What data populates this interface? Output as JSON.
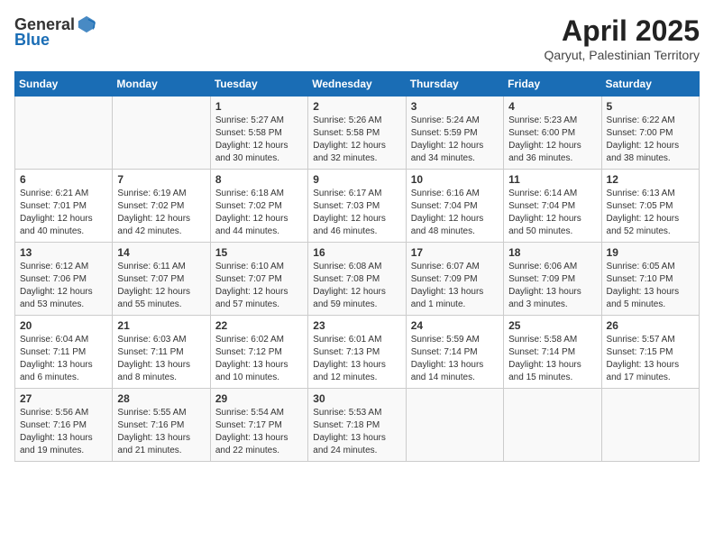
{
  "header": {
    "logo": {
      "text_general": "General",
      "text_blue": "Blue"
    },
    "title": "April 2025",
    "subtitle": "Qaryut, Palestinian Territory"
  },
  "calendar": {
    "days_of_week": [
      "Sunday",
      "Monday",
      "Tuesday",
      "Wednesday",
      "Thursday",
      "Friday",
      "Saturday"
    ],
    "weeks": [
      [
        {
          "day": "",
          "info": ""
        },
        {
          "day": "",
          "info": ""
        },
        {
          "day": "1",
          "info": "Sunrise: 5:27 AM\nSunset: 5:58 PM\nDaylight: 12 hours\nand 30 minutes."
        },
        {
          "day": "2",
          "info": "Sunrise: 5:26 AM\nSunset: 5:58 PM\nDaylight: 12 hours\nand 32 minutes."
        },
        {
          "day": "3",
          "info": "Sunrise: 5:24 AM\nSunset: 5:59 PM\nDaylight: 12 hours\nand 34 minutes."
        },
        {
          "day": "4",
          "info": "Sunrise: 5:23 AM\nSunset: 6:00 PM\nDaylight: 12 hours\nand 36 minutes."
        },
        {
          "day": "5",
          "info": "Sunrise: 6:22 AM\nSunset: 7:00 PM\nDaylight: 12 hours\nand 38 minutes."
        }
      ],
      [
        {
          "day": "6",
          "info": "Sunrise: 6:21 AM\nSunset: 7:01 PM\nDaylight: 12 hours\nand 40 minutes."
        },
        {
          "day": "7",
          "info": "Sunrise: 6:19 AM\nSunset: 7:02 PM\nDaylight: 12 hours\nand 42 minutes."
        },
        {
          "day": "8",
          "info": "Sunrise: 6:18 AM\nSunset: 7:02 PM\nDaylight: 12 hours\nand 44 minutes."
        },
        {
          "day": "9",
          "info": "Sunrise: 6:17 AM\nSunset: 7:03 PM\nDaylight: 12 hours\nand 46 minutes."
        },
        {
          "day": "10",
          "info": "Sunrise: 6:16 AM\nSunset: 7:04 PM\nDaylight: 12 hours\nand 48 minutes."
        },
        {
          "day": "11",
          "info": "Sunrise: 6:14 AM\nSunset: 7:04 PM\nDaylight: 12 hours\nand 50 minutes."
        },
        {
          "day": "12",
          "info": "Sunrise: 6:13 AM\nSunset: 7:05 PM\nDaylight: 12 hours\nand 52 minutes."
        }
      ],
      [
        {
          "day": "13",
          "info": "Sunrise: 6:12 AM\nSunset: 7:06 PM\nDaylight: 12 hours\nand 53 minutes."
        },
        {
          "day": "14",
          "info": "Sunrise: 6:11 AM\nSunset: 7:07 PM\nDaylight: 12 hours\nand 55 minutes."
        },
        {
          "day": "15",
          "info": "Sunrise: 6:10 AM\nSunset: 7:07 PM\nDaylight: 12 hours\nand 57 minutes."
        },
        {
          "day": "16",
          "info": "Sunrise: 6:08 AM\nSunset: 7:08 PM\nDaylight: 12 hours\nand 59 minutes."
        },
        {
          "day": "17",
          "info": "Sunrise: 6:07 AM\nSunset: 7:09 PM\nDaylight: 13 hours\nand 1 minute."
        },
        {
          "day": "18",
          "info": "Sunrise: 6:06 AM\nSunset: 7:09 PM\nDaylight: 13 hours\nand 3 minutes."
        },
        {
          "day": "19",
          "info": "Sunrise: 6:05 AM\nSunset: 7:10 PM\nDaylight: 13 hours\nand 5 minutes."
        }
      ],
      [
        {
          "day": "20",
          "info": "Sunrise: 6:04 AM\nSunset: 7:11 PM\nDaylight: 13 hours\nand 6 minutes."
        },
        {
          "day": "21",
          "info": "Sunrise: 6:03 AM\nSunset: 7:11 PM\nDaylight: 13 hours\nand 8 minutes."
        },
        {
          "day": "22",
          "info": "Sunrise: 6:02 AM\nSunset: 7:12 PM\nDaylight: 13 hours\nand 10 minutes."
        },
        {
          "day": "23",
          "info": "Sunrise: 6:01 AM\nSunset: 7:13 PM\nDaylight: 13 hours\nand 12 minutes."
        },
        {
          "day": "24",
          "info": "Sunrise: 5:59 AM\nSunset: 7:14 PM\nDaylight: 13 hours\nand 14 minutes."
        },
        {
          "day": "25",
          "info": "Sunrise: 5:58 AM\nSunset: 7:14 PM\nDaylight: 13 hours\nand 15 minutes."
        },
        {
          "day": "26",
          "info": "Sunrise: 5:57 AM\nSunset: 7:15 PM\nDaylight: 13 hours\nand 17 minutes."
        }
      ],
      [
        {
          "day": "27",
          "info": "Sunrise: 5:56 AM\nSunset: 7:16 PM\nDaylight: 13 hours\nand 19 minutes."
        },
        {
          "day": "28",
          "info": "Sunrise: 5:55 AM\nSunset: 7:16 PM\nDaylight: 13 hours\nand 21 minutes."
        },
        {
          "day": "29",
          "info": "Sunrise: 5:54 AM\nSunset: 7:17 PM\nDaylight: 13 hours\nand 22 minutes."
        },
        {
          "day": "30",
          "info": "Sunrise: 5:53 AM\nSunset: 7:18 PM\nDaylight: 13 hours\nand 24 minutes."
        },
        {
          "day": "",
          "info": ""
        },
        {
          "day": "",
          "info": ""
        },
        {
          "day": "",
          "info": ""
        }
      ]
    ]
  }
}
